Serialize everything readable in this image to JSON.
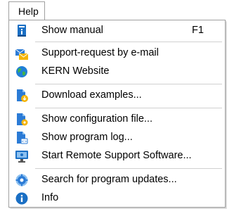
{
  "menubar": {
    "title": "Help"
  },
  "items": [
    {
      "label": "Show manual",
      "shortcut": "F1",
      "icon": "manual-book-icon"
    },
    {
      "label": "Support-request by e-mail",
      "icon": "email-support-icon"
    },
    {
      "label": "KERN Website",
      "icon": "globe-icon"
    },
    {
      "label": "Download examples...",
      "icon": "download-document-icon"
    },
    {
      "label": "Show configuration file...",
      "icon": "config-file-icon"
    },
    {
      "label": "Show program log...",
      "icon": "log-file-icon"
    },
    {
      "label": "Start Remote Support Software...",
      "icon": "remote-monitor-icon"
    },
    {
      "label": "Search for program updates...",
      "icon": "update-gear-icon"
    },
    {
      "label": "Info",
      "icon": "info-icon"
    }
  ],
  "colors": {
    "accent": "#1a73c8",
    "folder": "#f5b400",
    "separator": "#d0d0d0"
  }
}
